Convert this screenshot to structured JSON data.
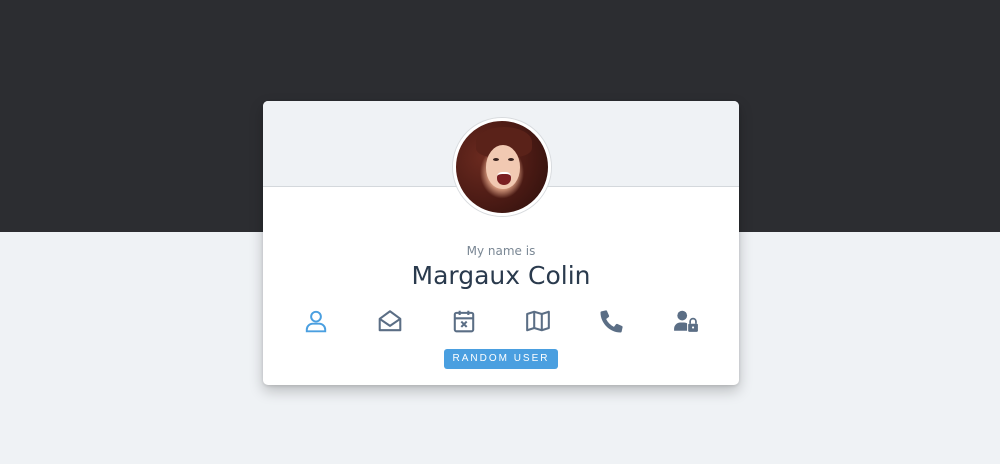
{
  "card": {
    "label": "My name is",
    "name": "Margaux Colin",
    "button_label": "RANDOM USER"
  },
  "icons": [
    {
      "name": "user-icon",
      "active": true
    },
    {
      "name": "envelope-open-icon",
      "active": false
    },
    {
      "name": "calendar-x-icon",
      "active": false
    },
    {
      "name": "map-icon",
      "active": false
    },
    {
      "name": "phone-icon",
      "active": false
    },
    {
      "name": "user-lock-icon",
      "active": false
    }
  ],
  "colors": {
    "top_band": "#2c2d31",
    "page_background": "#eff2f5",
    "accent": "#4a9fe0",
    "icon_default": "#5b6e85",
    "name_text": "#2a3a4d",
    "label_text": "#7a8794"
  }
}
